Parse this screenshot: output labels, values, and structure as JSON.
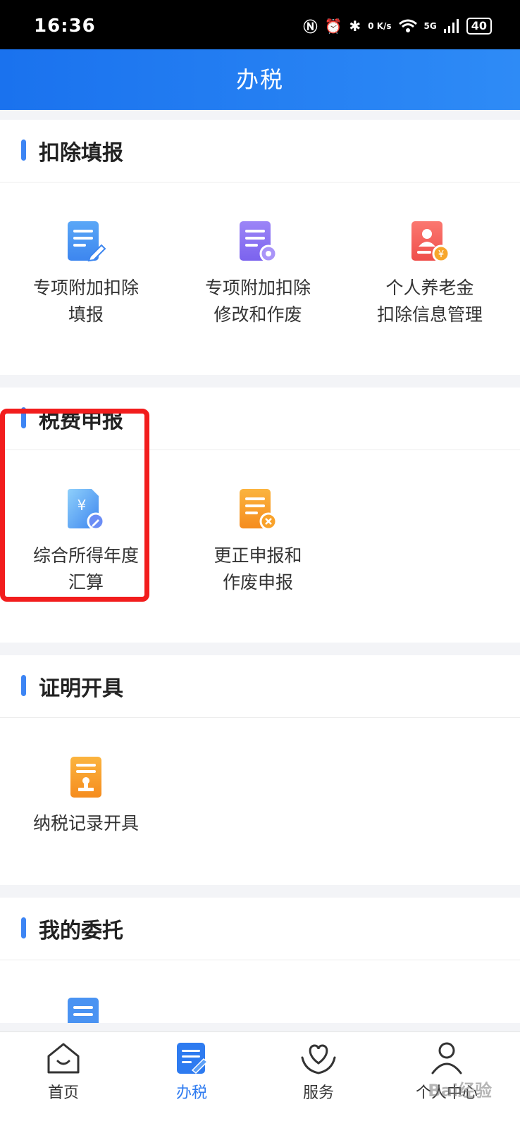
{
  "status": {
    "time": "16:36",
    "net_speed": "0 K/s",
    "signal": "5G",
    "battery": "40"
  },
  "header": {
    "title": "办税"
  },
  "sections": [
    {
      "title": "扣除填报",
      "items": [
        {
          "line1": "专项附加扣除",
          "line2": "填报"
        },
        {
          "line1": "专项附加扣除",
          "line2": "修改和作废"
        },
        {
          "line1": "个人养老金",
          "line2": "扣除信息管理"
        }
      ]
    },
    {
      "title": "税费申报",
      "items": [
        {
          "line1": "综合所得年度",
          "line2": "汇算"
        },
        {
          "line1": "更正申报和",
          "line2": "作废申报"
        }
      ]
    },
    {
      "title": "证明开具",
      "items": [
        {
          "line1": "纳税记录开具",
          "line2": ""
        }
      ]
    },
    {
      "title": "我的委托",
      "items": []
    }
  ],
  "tabs": [
    {
      "label": "首页"
    },
    {
      "label": "办税"
    },
    {
      "label": "服务"
    },
    {
      "label": "个人中心"
    }
  ],
  "watermark": "Bai经验",
  "colors": {
    "accent": "#2e7bf0",
    "highlight_box": "#f21d1d"
  }
}
